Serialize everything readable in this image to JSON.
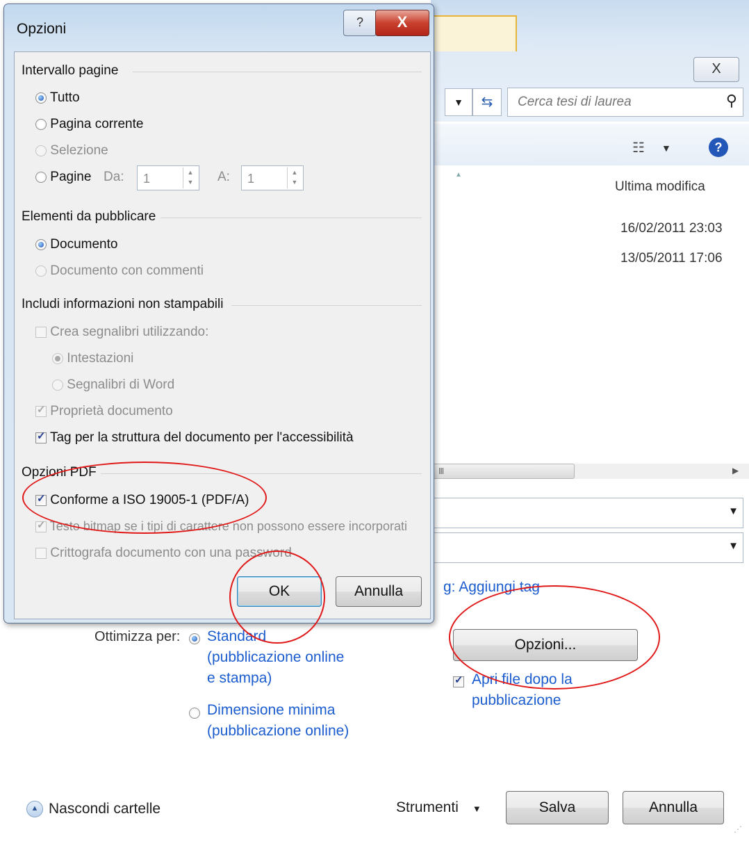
{
  "background": {
    "search": {
      "placeholder": "Cerca tesi di laurea"
    },
    "column_header": "Ultima modifica",
    "files": [
      {
        "modified": "16/02/2011 23:03"
      },
      {
        "modified": "13/05/2011 17:06"
      }
    ],
    "tags_link": "g: Aggiungi tag",
    "optimize": {
      "label": "Ottimizza per:",
      "option_standard": [
        "Standard",
        "(pubblicazione online",
        "e stampa)"
      ],
      "option_minimum": [
        "Dimensione minima",
        "(pubblicazione online)"
      ]
    },
    "options_button": "Opzioni...",
    "open_after": [
      "Apri file dopo la",
      "pubblicazione"
    ],
    "hide_folders": "Nascondi cartelle",
    "tools": "Strumenti",
    "save_button": "Salva",
    "cancel_button": "Annulla",
    "close_glyph": "X"
  },
  "dialog": {
    "title": "Opzioni",
    "help_glyph": "?",
    "close_glyph": "X",
    "page_range": {
      "header": "Intervallo pagine",
      "all": "Tutto",
      "current": "Pagina corrente",
      "selection": "Selezione",
      "pages": "Pagine",
      "from_label": "Da:",
      "from_value": "1",
      "to_label": "A:",
      "to_value": "1"
    },
    "publish": {
      "header": "Elementi da pubblicare",
      "document": "Documento",
      "with_comments": "Documento con commenti"
    },
    "nonprint": {
      "header": "Includi informazioni non stampabili",
      "bookmarks": "Crea segnalibri utilizzando:",
      "headings": "Intestazioni",
      "word_bookmarks": "Segnalibri di Word",
      "properties": "Proprietà documento",
      "tags": "Tag per la struttura del documento per l'accessibilità"
    },
    "pdf": {
      "header": "Opzioni PDF",
      "iso": "Conforme a ISO 19005-1 (PDF/A)",
      "bitmap": "Testo bitmap se i tipi di carattere non possono essere incorporati",
      "encrypt": "Crittografa documento con una password"
    },
    "ok_button": "OK",
    "cancel_button": "Annulla"
  },
  "colors": {
    "annotation": "#e01818",
    "link": "#1b5ccf"
  }
}
